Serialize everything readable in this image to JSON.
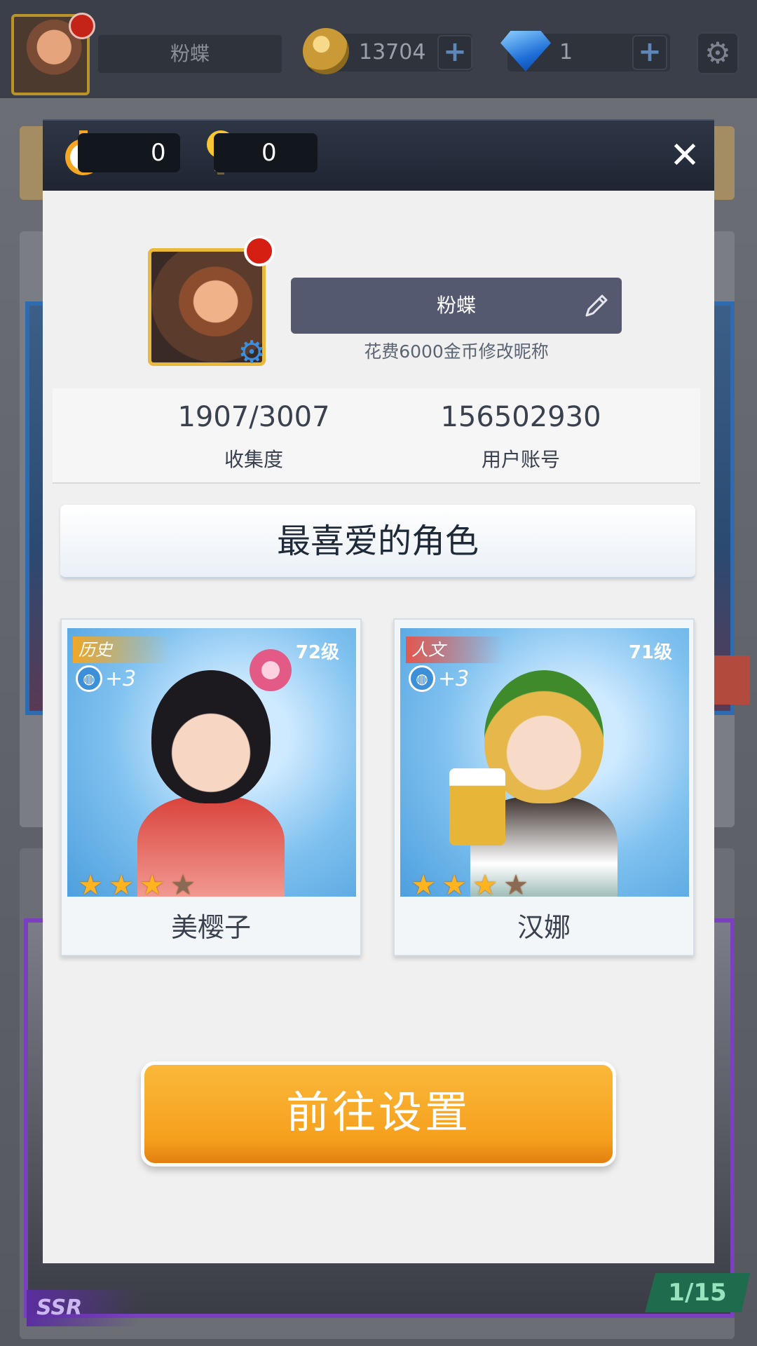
{
  "hud": {
    "player_name": "粉蝶",
    "coins": "13704",
    "gems": "1",
    "plus_label": "+",
    "settings_icon": "gear-icon"
  },
  "background": {
    "rarity_tag": "SSR",
    "page_counter": "1/15"
  },
  "modal": {
    "stopwatch_count": "0",
    "hint_count": "0",
    "close_label": "✕",
    "profile": {
      "nickname": "粉蝶",
      "rename_hint": "花费6000金币修改昵称"
    },
    "stats": [
      {
        "value": "1907/3007",
        "label": "收集度"
      },
      {
        "value": "156502930",
        "label": "用户账号"
      }
    ],
    "favorites_title": "最喜爱的角色",
    "characters": [
      {
        "name": "美樱子",
        "category": "历史",
        "level": "72级",
        "bonus": "+3",
        "stars": 3,
        "max_stars": 4
      },
      {
        "name": "汉娜",
        "category": "人文",
        "level": "71级",
        "bonus": "+3",
        "stars": 3,
        "max_stars": 4
      }
    ],
    "go_settings_label": "前往设置"
  },
  "colors": {
    "accent_orange": "#f5a01d",
    "header_navy": "#1f2532",
    "nickname_field": "#55596f",
    "notification_red": "#d51f12"
  }
}
